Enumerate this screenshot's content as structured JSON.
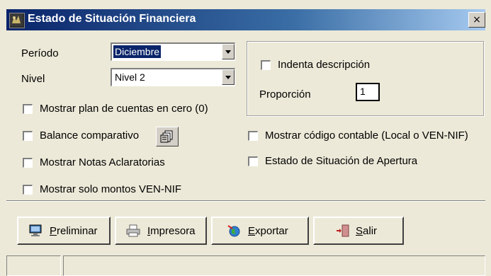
{
  "window": {
    "title": "Estado de Situación Financiera",
    "close": "×"
  },
  "form": {
    "periodo_label": "Período",
    "periodo_value": "Diciembre",
    "nivel_label": "Nivel",
    "nivel_value": "Nivel 2",
    "mostrar_plan_cero": "Mostrar plan de cuentas en cero (0)",
    "balance_comparativo": "Balance comparativo",
    "mostrar_notas": "Mostrar Notas Aclaratorias",
    "mostrar_solo_ven_nif": "Mostrar solo montos VEN-NIF",
    "indenta_descripcion": "Indenta descripción",
    "proporcion_label": "Proporción",
    "proporcion_value": "1",
    "mostrar_codigo_contable": "Mostrar código contable (Local o VEN-NIF)",
    "estado_apertura": "Estado de Situación de Apertura"
  },
  "buttons": {
    "preliminar_u": "P",
    "preliminar_rest": "reliminar",
    "impresora_u": "I",
    "impresora_rest": "mpresora",
    "exportar_u": "E",
    "exportar_rest": "xportar",
    "salir_u": "S",
    "salir_rest": "alir"
  },
  "colors": {
    "face": "#ece9d8",
    "titlebar_start": "#0a246a",
    "titlebar_end": "#a6caf0",
    "selection": "#0a246a"
  },
  "icons": [
    "app-icon",
    "close-icon",
    "copy-icon",
    "monitor-icon",
    "printer-icon",
    "globe-icon",
    "exit-door-icon"
  ]
}
